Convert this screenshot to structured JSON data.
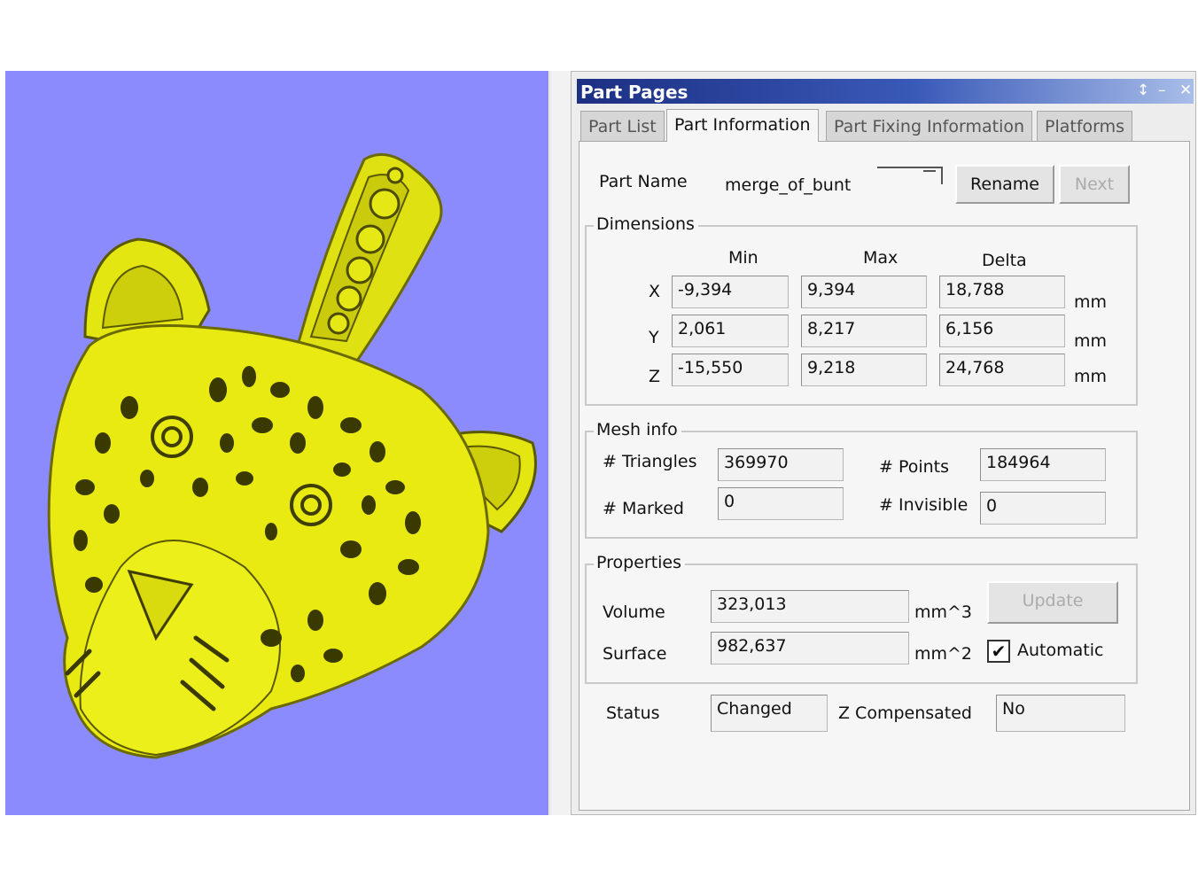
{
  "panel": {
    "title": "Part Pages",
    "controls": {
      "pin": "↕",
      "minimize": "–",
      "close": "✕"
    }
  },
  "tabs": [
    {
      "label": "Part List",
      "active": false
    },
    {
      "label": "Part Information",
      "active": true
    },
    {
      "label": "Part Fixing Information",
      "active": false
    },
    {
      "label": "Platforms",
      "active": false
    }
  ],
  "part": {
    "name_label": "Part Name",
    "name_value": "merge_of_bunt",
    "rename_label": "Rename",
    "next_label": "Next"
  },
  "dimensions": {
    "title": "Dimensions",
    "headers": {
      "min": "Min",
      "max": "Max",
      "delta": "Delta"
    },
    "rows": [
      {
        "axis": "X",
        "min": "-9,394",
        "max": "9,394",
        "delta": "18,788",
        "unit": "mm"
      },
      {
        "axis": "Y",
        "min": "2,061",
        "max": "8,217",
        "delta": "6,156",
        "unit": "mm"
      },
      {
        "axis": "Z",
        "min": "-15,550",
        "max": "9,218",
        "delta": "24,768",
        "unit": "mm"
      }
    ]
  },
  "mesh": {
    "title": "Mesh info",
    "triangles_label": "# Triangles",
    "triangles": "369970",
    "points_label": "# Points",
    "points": "184964",
    "marked_label": "# Marked",
    "marked": "0",
    "invisible_label": "# Invisible",
    "invisible": "0"
  },
  "properties": {
    "title": "Properties",
    "volume_label": "Volume",
    "volume": "323,013",
    "volume_unit": "mm^3",
    "surface_label": "Surface",
    "surface": "982,637",
    "surface_unit": "mm^2",
    "update_label": "Update",
    "automatic_label": "Automatic",
    "automatic_checked": "✔"
  },
  "status": {
    "label": "Status",
    "value": "Changed",
    "zcomp_label": "Z Compensated",
    "zcomp_value": "No"
  },
  "colors": {
    "viewport_bg": "#8b8bfd",
    "model": "#e8ea12",
    "title_bar": "#1c2f83"
  }
}
